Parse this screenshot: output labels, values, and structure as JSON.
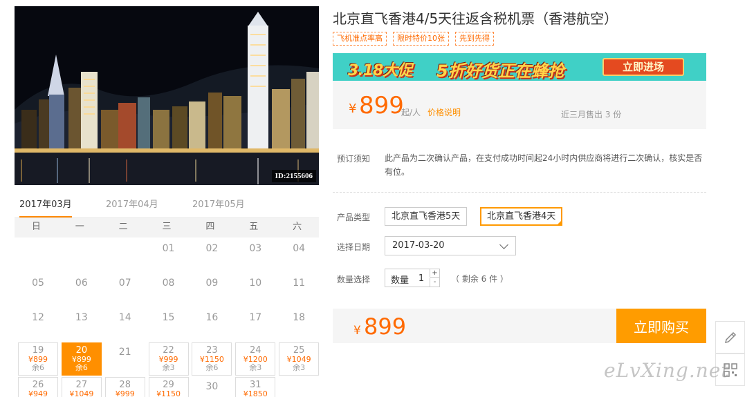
{
  "hero": {
    "image_id": "ID:2155606"
  },
  "product": {
    "title": "北京直飞香港4/5天往返含税机票（香港航空）",
    "tags": [
      "飞机准点率高",
      "限时特价10张",
      "先到先得"
    ]
  },
  "banner": {
    "promo": "3.18大促",
    "slogan": "5折好货正在蜂抢",
    "cta": "立即进场"
  },
  "price": {
    "currency": "¥",
    "amount": "899",
    "unit": "起/人",
    "explain_link": "价格说明",
    "sold": "近三月售出 3 份"
  },
  "notice": {
    "label": "预订须知",
    "text": "此产品为二次确认产品，在支付成功时间起24小时内供应商将进行二次确认，核实是否有位。"
  },
  "form": {
    "type_label": "产品类型",
    "types": [
      "北京直飞香港5天",
      "北京直飞香港4天"
    ],
    "selected_type": "北京直飞香港4天",
    "date_label": "选择日期",
    "date_value": "2017-03-20",
    "qty_label": "数量选择",
    "qty_prefix": "数量",
    "qty_value": "1",
    "qty_plus": "+",
    "qty_minus": "-",
    "remain": "（ 剩余 6 件 ）"
  },
  "total": {
    "currency": "¥",
    "amount": "899"
  },
  "buy_button": "立即购买",
  "calendar": {
    "months": [
      "2017年03月",
      "2017年04月",
      "2017年05月"
    ],
    "active_month": "2017年03月",
    "weekdays": [
      "日",
      "一",
      "二",
      "三",
      "四",
      "五",
      "六"
    ],
    "days": [
      {
        "d": "01",
        "col": 3,
        "row": 0
      },
      {
        "d": "02",
        "col": 4,
        "row": 0
      },
      {
        "d": "03",
        "col": 5,
        "row": 0
      },
      {
        "d": "04",
        "col": 6,
        "row": 0
      },
      {
        "d": "05",
        "col": 0,
        "row": 1
      },
      {
        "d": "06",
        "col": 1,
        "row": 1
      },
      {
        "d": "07",
        "col": 2,
        "row": 1
      },
      {
        "d": "08",
        "col": 3,
        "row": 1
      },
      {
        "d": "09",
        "col": 4,
        "row": 1
      },
      {
        "d": "10",
        "col": 5,
        "row": 1
      },
      {
        "d": "11",
        "col": 6,
        "row": 1
      },
      {
        "d": "12",
        "col": 0,
        "row": 2
      },
      {
        "d": "13",
        "col": 1,
        "row": 2
      },
      {
        "d": "14",
        "col": 2,
        "row": 2
      },
      {
        "d": "15",
        "col": 3,
        "row": 2
      },
      {
        "d": "16",
        "col": 4,
        "row": 2
      },
      {
        "d": "17",
        "col": 5,
        "row": 2
      },
      {
        "d": "18",
        "col": 6,
        "row": 2
      },
      {
        "d": "19",
        "col": 0,
        "row": 3,
        "price": "¥899",
        "remain": "余6"
      },
      {
        "d": "20",
        "col": 1,
        "row": 3,
        "price": "¥899",
        "remain": "余6",
        "selected": true
      },
      {
        "d": "21",
        "col": 2,
        "row": 3
      },
      {
        "d": "22",
        "col": 3,
        "row": 3,
        "price": "¥999",
        "remain": "余3"
      },
      {
        "d": "23",
        "col": 4,
        "row": 3,
        "price": "¥1150",
        "remain": "余6"
      },
      {
        "d": "24",
        "col": 5,
        "row": 3,
        "price": "¥1200",
        "remain": "余3"
      },
      {
        "d": "25",
        "col": 6,
        "row": 3,
        "price": "¥1049",
        "remain": "余3"
      },
      {
        "d": "26",
        "col": 0,
        "row": 4,
        "price": "¥949"
      },
      {
        "d": "27",
        "col": 1,
        "row": 4,
        "price": "¥1049"
      },
      {
        "d": "28",
        "col": 2,
        "row": 4,
        "price": "¥999"
      },
      {
        "d": "29",
        "col": 3,
        "row": 4,
        "price": "¥1150"
      },
      {
        "d": "30",
        "col": 4,
        "row": 4
      },
      {
        "d": "31",
        "col": 5,
        "row": 4,
        "price": "¥1850"
      }
    ]
  },
  "side_tools": [
    "pencil-icon",
    "qrcode-icon"
  ],
  "watermark": "eLvXing.net"
}
